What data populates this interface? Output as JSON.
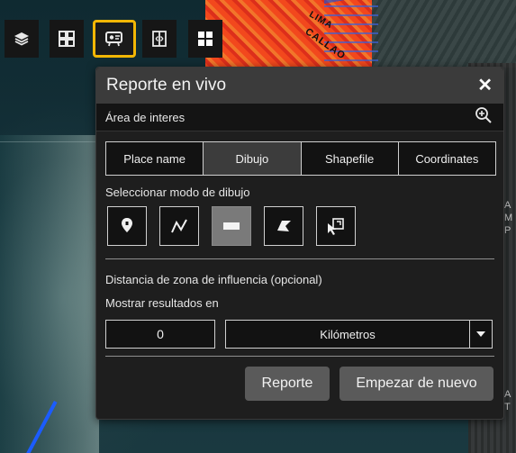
{
  "map": {
    "labels": {
      "lima": "LIMA",
      "callao": "CALLAO"
    },
    "side_labels": [
      "A",
      "M",
      "P",
      "A",
      "T"
    ]
  },
  "toolbar": {
    "buttons": [
      {
        "icon": "layers-icon"
      },
      {
        "icon": "basemap-gallery-icon"
      },
      {
        "icon": "report-icon",
        "active": true
      },
      {
        "icon": "swipe-icon"
      },
      {
        "icon": "widget-grid-icon"
      }
    ],
    "accent": "#f2b705"
  },
  "panel": {
    "title": "Reporte en vivo",
    "close": "✕",
    "area_label": "Área de interes",
    "tabs": [
      "Place name",
      "Dibujo",
      "Shapefile",
      "Coordinates"
    ],
    "active_tab": "Dibujo",
    "draw_mode_label": "Seleccionar modo de dibujo",
    "draw_modes": [
      "point",
      "polyline",
      "rectangle",
      "polygon",
      "select-feature"
    ],
    "active_draw_mode": "rectangle",
    "buffer_label": "Distancia de zona de influencia (opcional)",
    "results_label": "Mostrar resultados en",
    "distance_value": "0",
    "unit_value": "Kilómetros",
    "report_button": "Reporte",
    "reset_button": "Empezar de nuevo"
  }
}
